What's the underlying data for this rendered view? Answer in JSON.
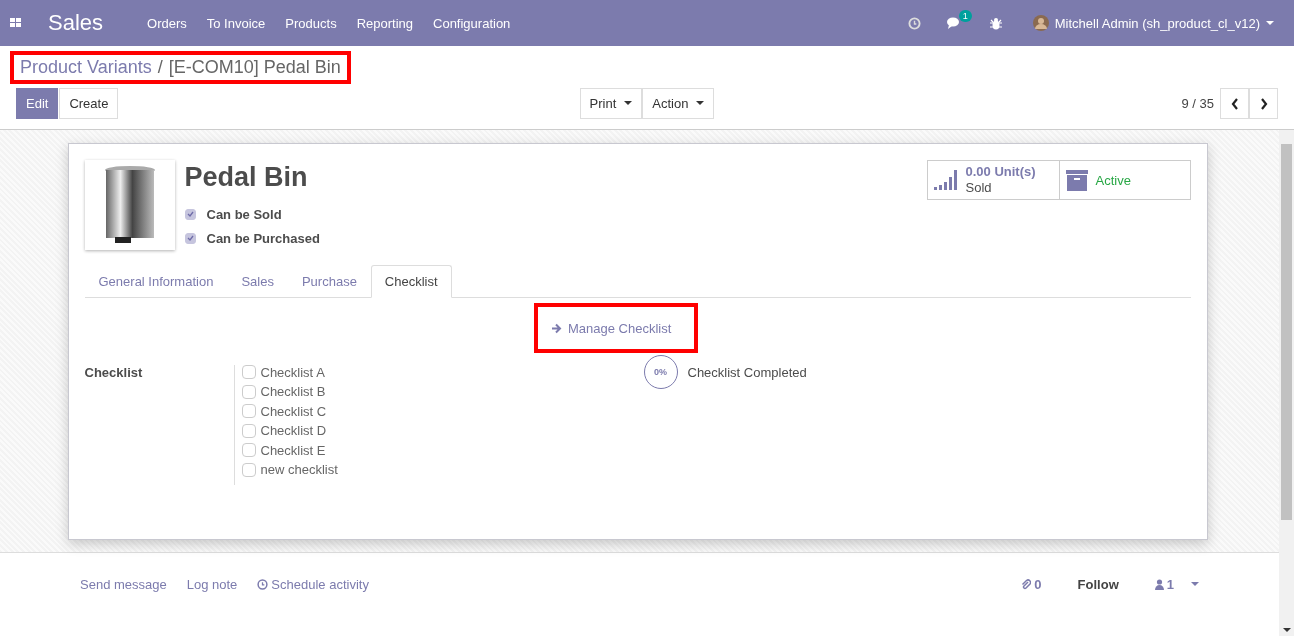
{
  "navbar": {
    "app_name": "Sales",
    "menu": [
      "Orders",
      "To Invoice",
      "Products",
      "Reporting",
      "Configuration"
    ],
    "chat_badge": "1",
    "user": "Mitchell Admin (sh_product_cl_v12)"
  },
  "breadcrumb": {
    "parent": "Product Variants",
    "separator": "/",
    "current": "[E-COM10] Pedal Bin"
  },
  "buttons": {
    "edit": "Edit",
    "create": "Create",
    "print": "Print",
    "action": "Action"
  },
  "pager": "9 / 35",
  "product": {
    "name": "Pedal Bin",
    "options": [
      {
        "label": "Can be Sold",
        "checked": true
      },
      {
        "label": "Can be Purchased",
        "checked": true
      }
    ]
  },
  "stat_buttons": {
    "sold_value": "0.00 Unit(s)",
    "sold_label": "Sold",
    "active_label": "Active"
  },
  "tabs": [
    {
      "label": "General Information",
      "selected": false
    },
    {
      "label": "Sales",
      "selected": false
    },
    {
      "label": "Purchase",
      "selected": false
    },
    {
      "label": "Checklist",
      "selected": true
    }
  ],
  "manage_link": "Manage Checklist",
  "checklist": {
    "label": "Checklist",
    "items": [
      {
        "label": "Checklist A",
        "checked": false
      },
      {
        "label": "Checklist B",
        "checked": false
      },
      {
        "label": "Checklist C",
        "checked": false
      },
      {
        "label": "Checklist D",
        "checked": false
      },
      {
        "label": "Checklist E",
        "checked": false
      },
      {
        "label": "new checklist",
        "checked": false
      }
    ],
    "percent": "0%",
    "completed_label": "Checklist Completed"
  },
  "chatter": {
    "send_message": "Send message",
    "log_note": "Log note",
    "schedule": "Schedule activity",
    "attachments": "0",
    "follow": "Follow",
    "followers": "1"
  }
}
